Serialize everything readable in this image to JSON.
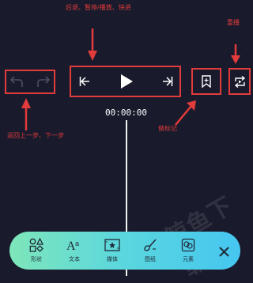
{
  "annotations": {
    "player_controls": "后退、暂停/播放、快进",
    "replay": "重播",
    "undo_redo": "返回上一步、下一步",
    "marker": "做标记"
  },
  "player": {
    "timecode": "00:00:00"
  },
  "toolbar": {
    "items": [
      {
        "label": "形状",
        "icon": "shapes-icon"
      },
      {
        "label": "文本",
        "icon": "text-icon"
      },
      {
        "label": "媒体",
        "icon": "media-icon"
      },
      {
        "label": "图纸",
        "icon": "drawing-icon"
      },
      {
        "label": "元素",
        "icon": "elements-icon"
      }
    ],
    "close_icon": "close-icon"
  },
  "watermark": "鲸鱼下载",
  "colors": {
    "background": "#191b2c",
    "annotation_red": "#e23b3b",
    "toolbar_gradient_start": "#7ee6b9",
    "toolbar_gradient_end": "#45c6f0"
  }
}
